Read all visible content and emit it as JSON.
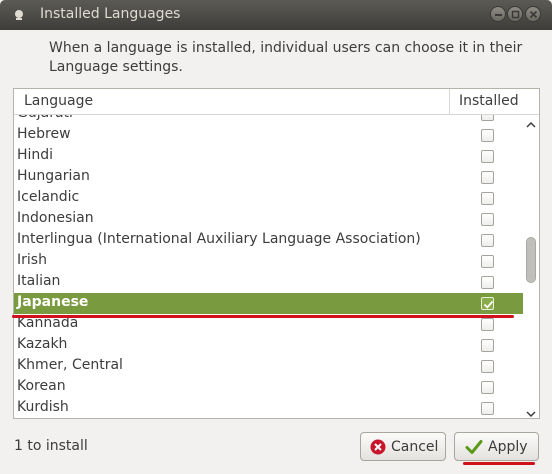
{
  "window": {
    "title": "Installed Languages"
  },
  "intro_text": "When a language is installed, individual users can choose it in their Language settings.",
  "columns": {
    "language": "Language",
    "installed": "Installed"
  },
  "rows": [
    {
      "label": "Gujarati",
      "installed": false
    },
    {
      "label": "Hebrew",
      "installed": false
    },
    {
      "label": "Hindi",
      "installed": false
    },
    {
      "label": "Hungarian",
      "installed": false
    },
    {
      "label": "Icelandic",
      "installed": false
    },
    {
      "label": "Indonesian",
      "installed": false
    },
    {
      "label": "Interlingua (International Auxiliary Language Association)",
      "installed": false
    },
    {
      "label": "Irish",
      "installed": false
    },
    {
      "label": "Italian",
      "installed": false
    },
    {
      "label": "Japanese",
      "installed": true,
      "selected": true
    },
    {
      "label": "Kannada",
      "installed": false
    },
    {
      "label": "Kazakh",
      "installed": false
    },
    {
      "label": "Khmer, Central",
      "installed": false
    },
    {
      "label": "Korean",
      "installed": false
    },
    {
      "label": "Kurdish",
      "installed": false
    }
  ],
  "status_text": "1 to install",
  "buttons": {
    "cancel": "Cancel",
    "apply": "Apply"
  },
  "colors": {
    "selected_row": "#7a9a3f",
    "annotation_underline": "#d0101a",
    "titlebar": "#3e3d39"
  },
  "icons": {
    "title": "window-app-icon",
    "minimize": "minimize-icon",
    "maximize": "maximize-icon",
    "close": "close-icon",
    "cancel": "cancel-icon",
    "apply": "checkmark-icon"
  }
}
